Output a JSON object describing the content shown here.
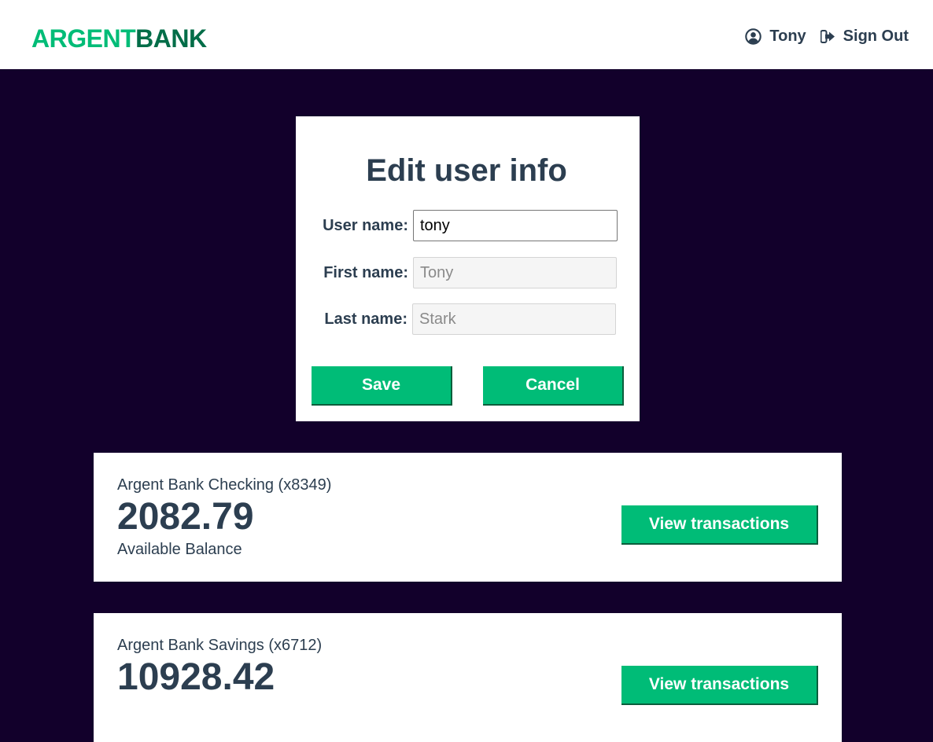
{
  "header": {
    "logo_part1": "ARGENT",
    "logo_part2": "BANK",
    "user_name": "Tony",
    "sign_out_label": "Sign Out",
    "user_icon": "user-circle-icon",
    "sign_out_icon": "sign-out-icon"
  },
  "edit_form": {
    "title": "Edit user info",
    "username_label": "User name:",
    "username_value": "tony",
    "firstname_label": "First name:",
    "firstname_value": "Tony",
    "lastname_label": "Last name:",
    "lastname_value": "Stark",
    "save_label": "Save",
    "cancel_label": "Cancel"
  },
  "accounts": [
    {
      "title": "Argent Bank Checking (x8349)",
      "amount": "2082.79",
      "description": "Available Balance",
      "button_label": "View transactions"
    },
    {
      "title": "Argent Bank Savings (x6712)",
      "amount": "10928.42",
      "button_label": "View transactions"
    }
  ],
  "colors": {
    "background": "#12002b",
    "accent": "#00bc77",
    "logo_dark": "#026d48",
    "text": "#2c3e50"
  }
}
